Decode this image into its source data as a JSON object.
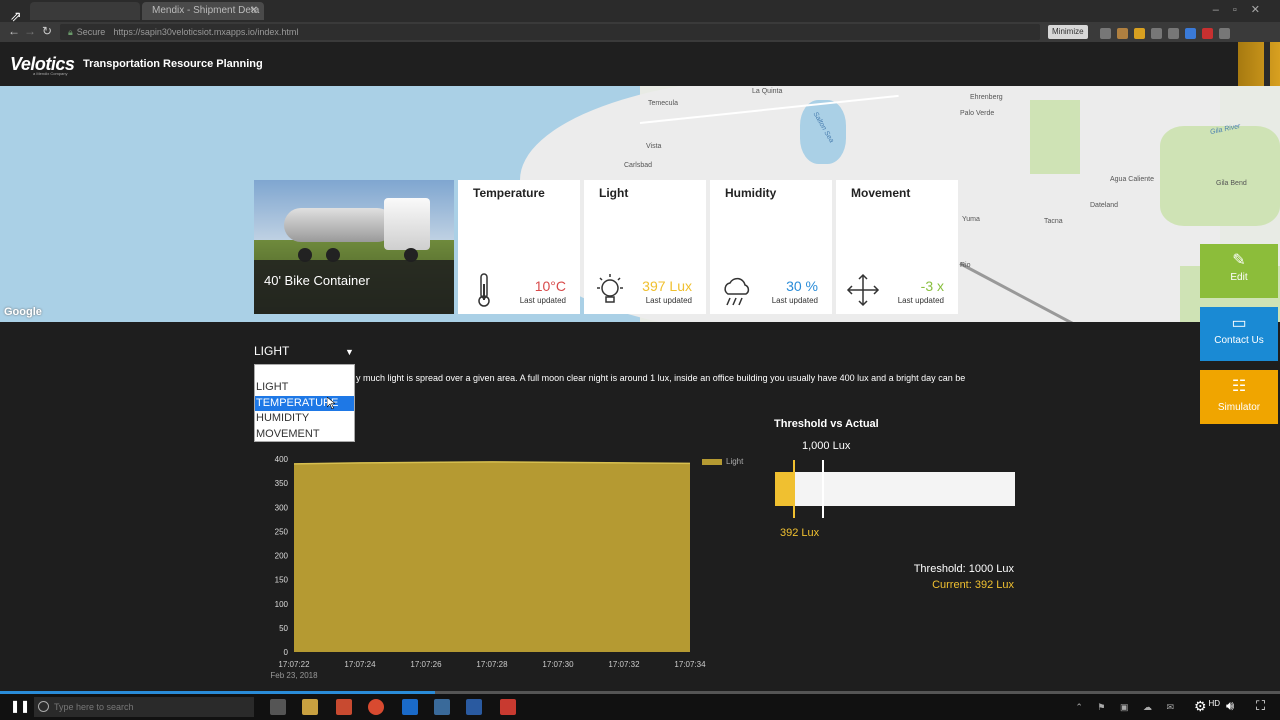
{
  "browser": {
    "tabs": [
      {
        "label": "",
        "active": false
      },
      {
        "label": "Mendix - Shipment Deta",
        "active": true
      }
    ],
    "url": "https://sapin30veloticsiot.mxapps.io/index.html",
    "secure_label": "Secure",
    "minimize_label": "Minimize"
  },
  "app": {
    "logo": "Velotics",
    "logo_sub": "a Mendix Company",
    "title": "Transportation Resource Planning"
  },
  "map": {
    "labels": [
      "Temecula",
      "La Quinta",
      "Vista",
      "Carlsbad",
      "Salton Sea",
      "Palo Verde",
      "Ehrenberg",
      "Gila River",
      "Agua Caliente",
      "Gila Bend",
      "Dateland",
      "Yuma",
      "Tacna",
      "Rio"
    ],
    "attribution": "Google"
  },
  "shipment": {
    "name": "40' Bike Container"
  },
  "sensors": [
    {
      "title": "Temperature",
      "value": "10°C",
      "updated": "Last updated",
      "color": "#d84a4a",
      "icon": "thermometer-icon"
    },
    {
      "title": "Light",
      "value": "397 Lux",
      "updated": "Last updated",
      "color": "#f0c030",
      "icon": "lightbulb-icon"
    },
    {
      "title": "Humidity",
      "value": "30 %",
      "updated": "Last updated",
      "color": "#2a8cd8",
      "icon": "cloud-rain-icon"
    },
    {
      "title": "Movement",
      "value": "-3 x",
      "updated": "Last updated",
      "color": "#8ac040",
      "icon": "move-arrows-icon"
    }
  ],
  "actions": [
    {
      "label": "Edit",
      "color": "#8cbd3a",
      "icon": "pencil-icon"
    },
    {
      "label": "Contact Us",
      "color": "#1a8ad4",
      "icon": "chat-icon"
    },
    {
      "label": "Simulator",
      "color": "#f0a500",
      "icon": "sliders-icon"
    }
  ],
  "selector": {
    "selected": "LIGHT",
    "options": [
      "LIGHT",
      "TEMPERATURE",
      "HUMIDITY",
      "MOVEMENT"
    ],
    "highlighted": "TEMPERATURE"
  },
  "description": "y much light is spread over a given area. A full moon clear night is around 1 lux, inside an office building you usually have 400 lux and a bright day can be",
  "chart_data": {
    "type": "area",
    "x": [
      "17:07:22",
      "17:07:24",
      "17:07:26",
      "17:07:28",
      "17:07:30",
      "17:07:32",
      "17:07:34"
    ],
    "x_sublabel": "Feb 23, 2018",
    "series": [
      {
        "name": "Light",
        "values": [
          390,
          392,
          393,
          394,
          393,
          392,
          391
        ]
      }
    ],
    "ylim": [
      0,
      400
    ],
    "yticks": [
      0,
      50,
      100,
      150,
      200,
      250,
      300,
      350,
      400
    ],
    "color": "#b59a32",
    "legend": "top-right"
  },
  "threshold": {
    "title": "Threshold vs Actual",
    "max_label": "1,000 Lux",
    "current_label": "392 Lux",
    "threshold_text": "Threshold: 1000 Lux",
    "current_text": "Current: 392 Lux",
    "scale_max": 5000,
    "current": 392,
    "threshold": 1000
  },
  "taskbar": {
    "search_placeholder": "Type here to search",
    "hd_label": "HD",
    "progress": 0.34
  }
}
